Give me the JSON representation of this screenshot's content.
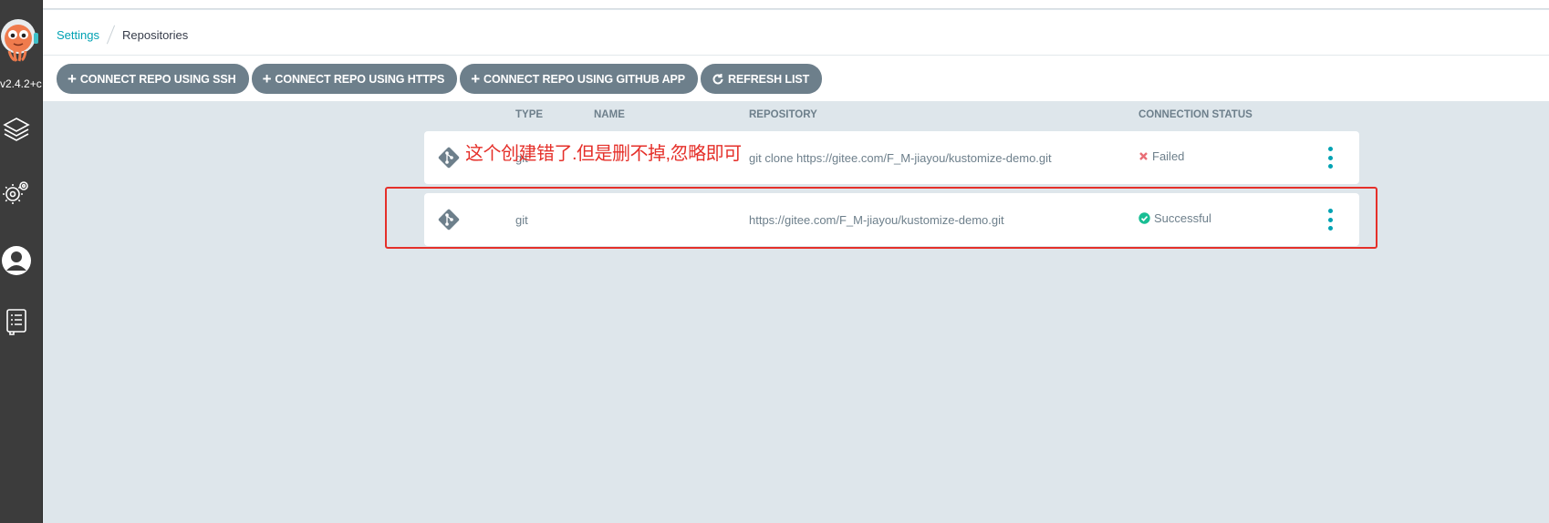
{
  "app": {
    "version": "v2.4.2+c"
  },
  "breadcrumb": {
    "parent": "Settings",
    "current": "Repositories"
  },
  "toolbar": {
    "ssh_label": "CONNECT REPO USING SSH",
    "https_label": "CONNECT REPO USING HTTPS",
    "github_label": "CONNECT REPO USING GITHUB APP",
    "refresh_label": "REFRESH LIST"
  },
  "table": {
    "headers": {
      "type": "TYPE",
      "name": "NAME",
      "repository": "REPOSITORY",
      "status": "CONNECTION STATUS"
    },
    "rows": [
      {
        "type": "git",
        "name": "",
        "repository": "git clone https://gitee.com/F_M-jiayou/kustomize-demo.git",
        "status": "Failed",
        "status_icon": "x-icon"
      },
      {
        "type": "git",
        "name": "",
        "repository": "https://gitee.com/F_M-jiayou/kustomize-demo.git",
        "status": "Successful",
        "status_icon": "check-circle-icon"
      }
    ]
  },
  "annotation": {
    "text": "这个创建错了.但是删不掉,忽略即可"
  },
  "colors": {
    "accent": "#00a2b3",
    "button": "#6d7f8b",
    "annotation": "#e5302a",
    "success": "#18be94",
    "failed": "#e96d76"
  }
}
